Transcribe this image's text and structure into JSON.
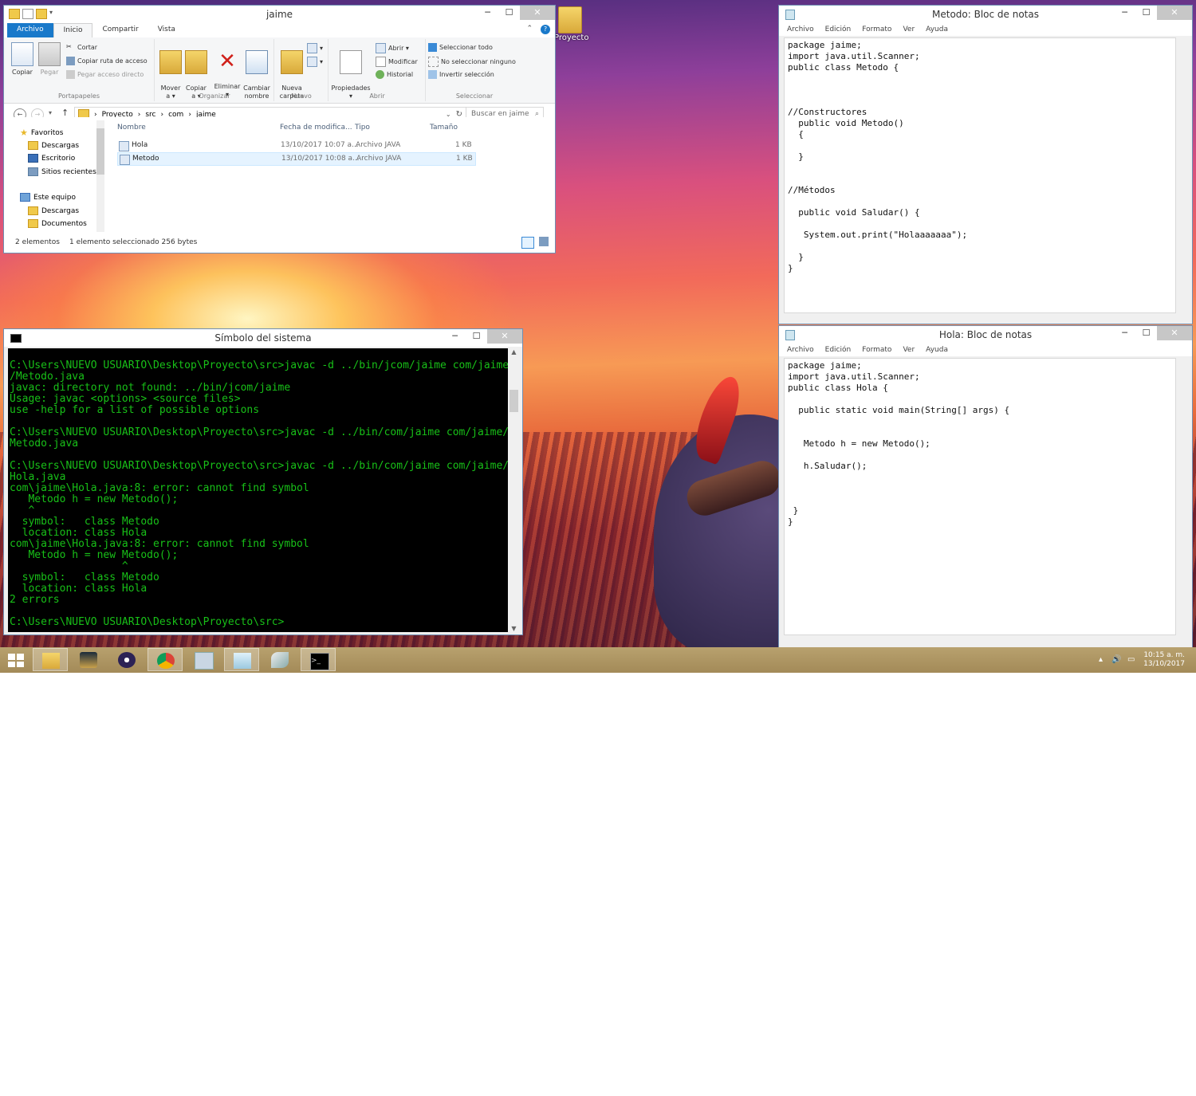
{
  "desktop": {
    "icon_label": "Proyecto"
  },
  "explorer": {
    "title": "jaime",
    "tabs": [
      "Archivo",
      "Inicio",
      "Compartir",
      "Vista"
    ],
    "ribbon": {
      "copiar": "Copiar",
      "pegar": "Pegar",
      "cortar": "Cortar",
      "copiar_ruta": "Copiar ruta de acceso",
      "pegar_acceso": "Pegar acceso directo",
      "portapapeles": "Portapapeles",
      "mover": "Mover\na ▾",
      "copiar_a": "Copiar\na ▾",
      "eliminar": "Eliminar\n▾",
      "cambiar": "Cambiar\nnombre",
      "organizar": "Organizar",
      "nueva": "Nueva\ncarpeta",
      "nuevo": "Nuevo",
      "propiedades": "Propiedades\n▾",
      "abrir_btn": "Abrir ▾",
      "modificar": "Modificar",
      "historial": "Historial",
      "abrir": "Abrir",
      "sel_todo": "Seleccionar todo",
      "no_sel": "No seleccionar ninguno",
      "invertir": "Invertir selección",
      "seleccionar": "Seleccionar"
    },
    "breadcrumb": [
      "Proyecto",
      "src",
      "com",
      "jaime"
    ],
    "search_placeholder": "Buscar en jaime",
    "nav": {
      "favoritos": "Favoritos",
      "descargas": "Descargas",
      "escritorio": "Escritorio",
      "recientes": "Sitios recientes",
      "equipo": "Este equipo",
      "descargas2": "Descargas",
      "documentos": "Documentos"
    },
    "columns": [
      "Nombre",
      "Fecha de modifica...",
      "Tipo",
      "Tamaño"
    ],
    "files": [
      {
        "name": "Hola",
        "date": "13/10/2017 10:07 a...",
        "type": "Archivo JAVA",
        "size": "1 KB"
      },
      {
        "name": "Metodo",
        "date": "13/10/2017 10:08 a...",
        "type": "Archivo JAVA",
        "size": "1 KB"
      }
    ],
    "status_count": "2 elementos",
    "status_selected": "1 elemento seleccionado  256 bytes"
  },
  "cmd": {
    "title": "Símbolo del sistema",
    "lines": [
      "C:\\Users\\NUEVO USUARIO\\Desktop\\Proyecto\\src>javac -d ../bin/jcom/jaime com/jaime",
      "/Metodo.java",
      "javac: directory not found: ../bin/jcom/jaime",
      "Usage: javac <options> <source files>",
      "use -help for a list of possible options",
      "",
      "C:\\Users\\NUEVO USUARIO\\Desktop\\Proyecto\\src>javac -d ../bin/com/jaime com/jaime/",
      "Metodo.java",
      "",
      "C:\\Users\\NUEVO USUARIO\\Desktop\\Proyecto\\src>javac -d ../bin/com/jaime com/jaime/",
      "Hola.java",
      "com\\jaime\\Hola.java:8: error: cannot find symbol",
      "   Metodo h = new Metodo();",
      "   ^",
      "  symbol:   class Metodo",
      "  location: class Hola",
      "com\\jaime\\Hola.java:8: error: cannot find symbol",
      "   Metodo h = new Metodo();",
      "                  ^",
      "  symbol:   class Metodo",
      "  location: class Hola",
      "2 errors",
      "",
      "C:\\Users\\NUEVO USUARIO\\Desktop\\Proyecto\\src>"
    ]
  },
  "menu": [
    "Archivo",
    "Edición",
    "Formato",
    "Ver",
    "Ayuda"
  ],
  "notepad_metodo": {
    "title": "Metodo: Bloc de notas",
    "lines": [
      "package jaime;",
      "import java.util.Scanner;",
      "public class Metodo {",
      "",
      "",
      "",
      "//Constructores",
      "  public void Metodo()",
      "  {",
      "",
      "  }",
      "",
      "",
      "//Métodos",
      "",
      "  public void Saludar() {",
      "",
      "   System.out.print(\"Holaaaaaaa\");",
      "",
      "  }",
      "}"
    ]
  },
  "notepad_hola": {
    "title": "Hola: Bloc de notas",
    "lines": [
      "package jaime;",
      "import java.util.Scanner;",
      "public class Hola {",
      "",
      "  public static void main(String[] args) {",
      "",
      "",
      "   Metodo h = new Metodo();",
      "",
      "   h.Saludar();",
      "",
      "",
      "",
      " }",
      "}"
    ]
  },
  "taskbar": {
    "time": "10:15 a. m.",
    "date": "13/10/2017",
    "apps": [
      "start-icon",
      "file-explorer-icon",
      "league-of-legends-icon",
      "eclipse-icon",
      "chrome-icon",
      "calculator-icon",
      "notepad-icon",
      "tools-icon",
      "cmd-icon"
    ]
  }
}
